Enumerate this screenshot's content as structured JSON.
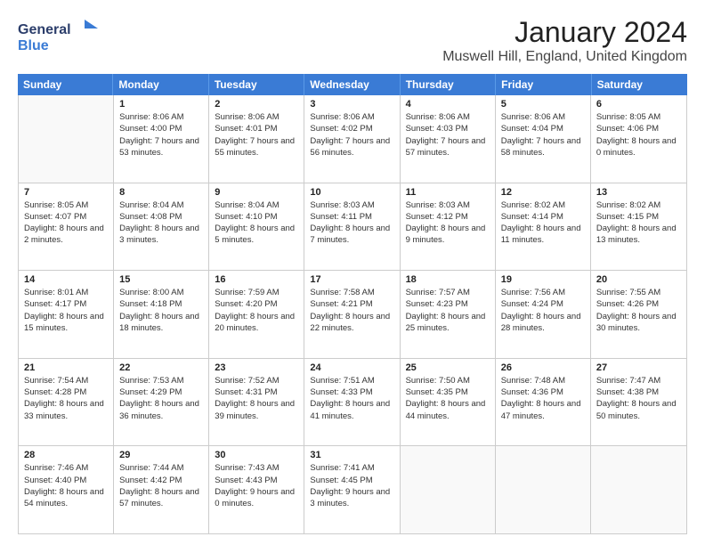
{
  "logo": {
    "line1": "General",
    "line2": "Blue"
  },
  "title": "January 2024",
  "subtitle": "Muswell Hill, England, United Kingdom",
  "header": {
    "days": [
      "Sunday",
      "Monday",
      "Tuesday",
      "Wednesday",
      "Thursday",
      "Friday",
      "Saturday"
    ]
  },
  "weeks": [
    [
      {
        "day": "",
        "sunrise": "",
        "sunset": "",
        "daylight": "",
        "empty": true
      },
      {
        "day": "1",
        "sunrise": "Sunrise: 8:06 AM",
        "sunset": "Sunset: 4:00 PM",
        "daylight": "Daylight: 7 hours and 53 minutes."
      },
      {
        "day": "2",
        "sunrise": "Sunrise: 8:06 AM",
        "sunset": "Sunset: 4:01 PM",
        "daylight": "Daylight: 7 hours and 55 minutes."
      },
      {
        "day": "3",
        "sunrise": "Sunrise: 8:06 AM",
        "sunset": "Sunset: 4:02 PM",
        "daylight": "Daylight: 7 hours and 56 minutes."
      },
      {
        "day": "4",
        "sunrise": "Sunrise: 8:06 AM",
        "sunset": "Sunset: 4:03 PM",
        "daylight": "Daylight: 7 hours and 57 minutes."
      },
      {
        "day": "5",
        "sunrise": "Sunrise: 8:06 AM",
        "sunset": "Sunset: 4:04 PM",
        "daylight": "Daylight: 7 hours and 58 minutes."
      },
      {
        "day": "6",
        "sunrise": "Sunrise: 8:05 AM",
        "sunset": "Sunset: 4:06 PM",
        "daylight": "Daylight: 8 hours and 0 minutes."
      }
    ],
    [
      {
        "day": "7",
        "sunrise": "Sunrise: 8:05 AM",
        "sunset": "Sunset: 4:07 PM",
        "daylight": "Daylight: 8 hours and 2 minutes."
      },
      {
        "day": "8",
        "sunrise": "Sunrise: 8:04 AM",
        "sunset": "Sunset: 4:08 PM",
        "daylight": "Daylight: 8 hours and 3 minutes."
      },
      {
        "day": "9",
        "sunrise": "Sunrise: 8:04 AM",
        "sunset": "Sunset: 4:10 PM",
        "daylight": "Daylight: 8 hours and 5 minutes."
      },
      {
        "day": "10",
        "sunrise": "Sunrise: 8:03 AM",
        "sunset": "Sunset: 4:11 PM",
        "daylight": "Daylight: 8 hours and 7 minutes."
      },
      {
        "day": "11",
        "sunrise": "Sunrise: 8:03 AM",
        "sunset": "Sunset: 4:12 PM",
        "daylight": "Daylight: 8 hours and 9 minutes."
      },
      {
        "day": "12",
        "sunrise": "Sunrise: 8:02 AM",
        "sunset": "Sunset: 4:14 PM",
        "daylight": "Daylight: 8 hours and 11 minutes."
      },
      {
        "day": "13",
        "sunrise": "Sunrise: 8:02 AM",
        "sunset": "Sunset: 4:15 PM",
        "daylight": "Daylight: 8 hours and 13 minutes."
      }
    ],
    [
      {
        "day": "14",
        "sunrise": "Sunrise: 8:01 AM",
        "sunset": "Sunset: 4:17 PM",
        "daylight": "Daylight: 8 hours and 15 minutes."
      },
      {
        "day": "15",
        "sunrise": "Sunrise: 8:00 AM",
        "sunset": "Sunset: 4:18 PM",
        "daylight": "Daylight: 8 hours and 18 minutes."
      },
      {
        "day": "16",
        "sunrise": "Sunrise: 7:59 AM",
        "sunset": "Sunset: 4:20 PM",
        "daylight": "Daylight: 8 hours and 20 minutes."
      },
      {
        "day": "17",
        "sunrise": "Sunrise: 7:58 AM",
        "sunset": "Sunset: 4:21 PM",
        "daylight": "Daylight: 8 hours and 22 minutes."
      },
      {
        "day": "18",
        "sunrise": "Sunrise: 7:57 AM",
        "sunset": "Sunset: 4:23 PM",
        "daylight": "Daylight: 8 hours and 25 minutes."
      },
      {
        "day": "19",
        "sunrise": "Sunrise: 7:56 AM",
        "sunset": "Sunset: 4:24 PM",
        "daylight": "Daylight: 8 hours and 28 minutes."
      },
      {
        "day": "20",
        "sunrise": "Sunrise: 7:55 AM",
        "sunset": "Sunset: 4:26 PM",
        "daylight": "Daylight: 8 hours and 30 minutes."
      }
    ],
    [
      {
        "day": "21",
        "sunrise": "Sunrise: 7:54 AM",
        "sunset": "Sunset: 4:28 PM",
        "daylight": "Daylight: 8 hours and 33 minutes."
      },
      {
        "day": "22",
        "sunrise": "Sunrise: 7:53 AM",
        "sunset": "Sunset: 4:29 PM",
        "daylight": "Daylight: 8 hours and 36 minutes."
      },
      {
        "day": "23",
        "sunrise": "Sunrise: 7:52 AM",
        "sunset": "Sunset: 4:31 PM",
        "daylight": "Daylight: 8 hours and 39 minutes."
      },
      {
        "day": "24",
        "sunrise": "Sunrise: 7:51 AM",
        "sunset": "Sunset: 4:33 PM",
        "daylight": "Daylight: 8 hours and 41 minutes."
      },
      {
        "day": "25",
        "sunrise": "Sunrise: 7:50 AM",
        "sunset": "Sunset: 4:35 PM",
        "daylight": "Daylight: 8 hours and 44 minutes."
      },
      {
        "day": "26",
        "sunrise": "Sunrise: 7:48 AM",
        "sunset": "Sunset: 4:36 PM",
        "daylight": "Daylight: 8 hours and 47 minutes."
      },
      {
        "day": "27",
        "sunrise": "Sunrise: 7:47 AM",
        "sunset": "Sunset: 4:38 PM",
        "daylight": "Daylight: 8 hours and 50 minutes."
      }
    ],
    [
      {
        "day": "28",
        "sunrise": "Sunrise: 7:46 AM",
        "sunset": "Sunset: 4:40 PM",
        "daylight": "Daylight: 8 hours and 54 minutes."
      },
      {
        "day": "29",
        "sunrise": "Sunrise: 7:44 AM",
        "sunset": "Sunset: 4:42 PM",
        "daylight": "Daylight: 8 hours and 57 minutes."
      },
      {
        "day": "30",
        "sunrise": "Sunrise: 7:43 AM",
        "sunset": "Sunset: 4:43 PM",
        "daylight": "Daylight: 9 hours and 0 minutes."
      },
      {
        "day": "31",
        "sunrise": "Sunrise: 7:41 AM",
        "sunset": "Sunset: 4:45 PM",
        "daylight": "Daylight: 9 hours and 3 minutes."
      },
      {
        "day": "",
        "sunrise": "",
        "sunset": "",
        "daylight": "",
        "empty": true
      },
      {
        "day": "",
        "sunrise": "",
        "sunset": "",
        "daylight": "",
        "empty": true
      },
      {
        "day": "",
        "sunrise": "",
        "sunset": "",
        "daylight": "",
        "empty": true
      }
    ]
  ]
}
